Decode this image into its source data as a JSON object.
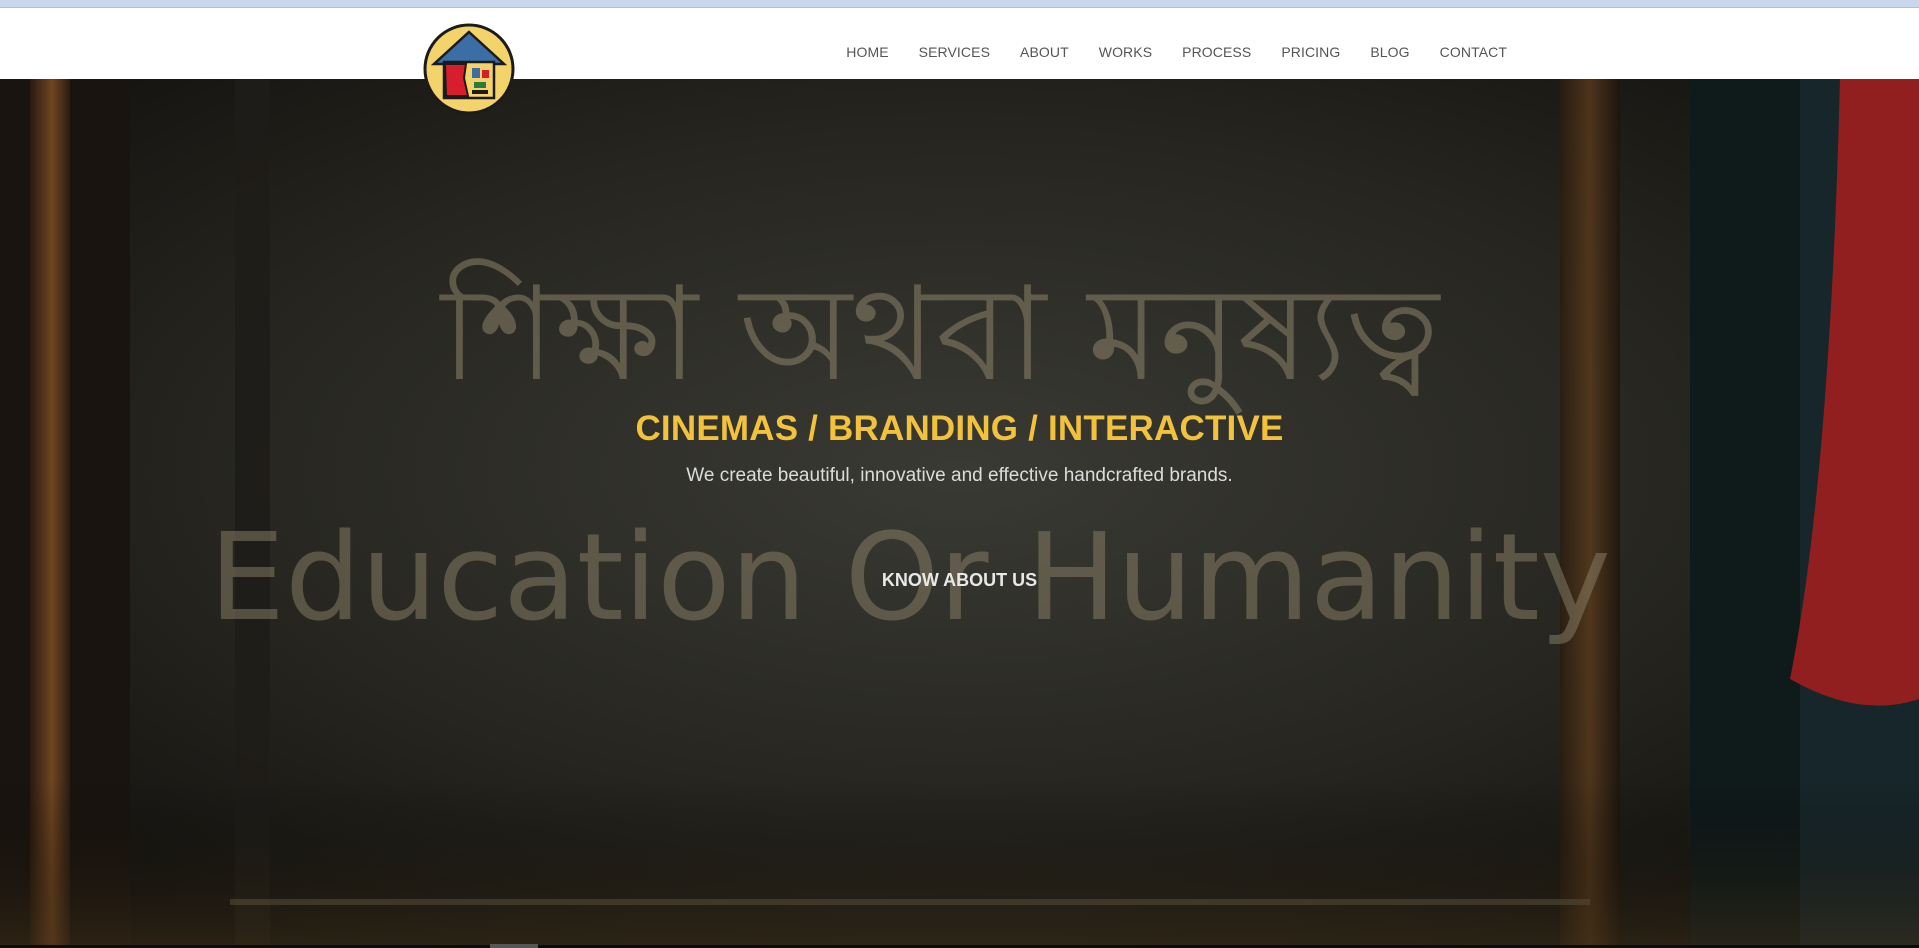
{
  "nav": {
    "items": [
      {
        "label": "HOME"
      },
      {
        "label": "SERVICES"
      },
      {
        "label": "ABOUT"
      },
      {
        "label": "WORKS"
      },
      {
        "label": "PROCESS"
      },
      {
        "label": "PRICING"
      },
      {
        "label": "BLOG"
      },
      {
        "label": "CONTACT"
      }
    ]
  },
  "logo": {
    "icon": "house-logo-icon"
  },
  "hero": {
    "headline": "CINEMAS / BRANDING / INTERACTIVE",
    "subhead": "We create beautiful, innovative and effective handcrafted brands.",
    "cta": "KNOW ABOUT US",
    "chalk_line_1": "শিক্ষা অথবা মনুষ্যত্ব",
    "chalk_line_2": "Education Or Humanity"
  },
  "colors": {
    "accent": "#f2c23c",
    "nav_text": "#555555",
    "hero_overlay": "#1b1a15"
  }
}
